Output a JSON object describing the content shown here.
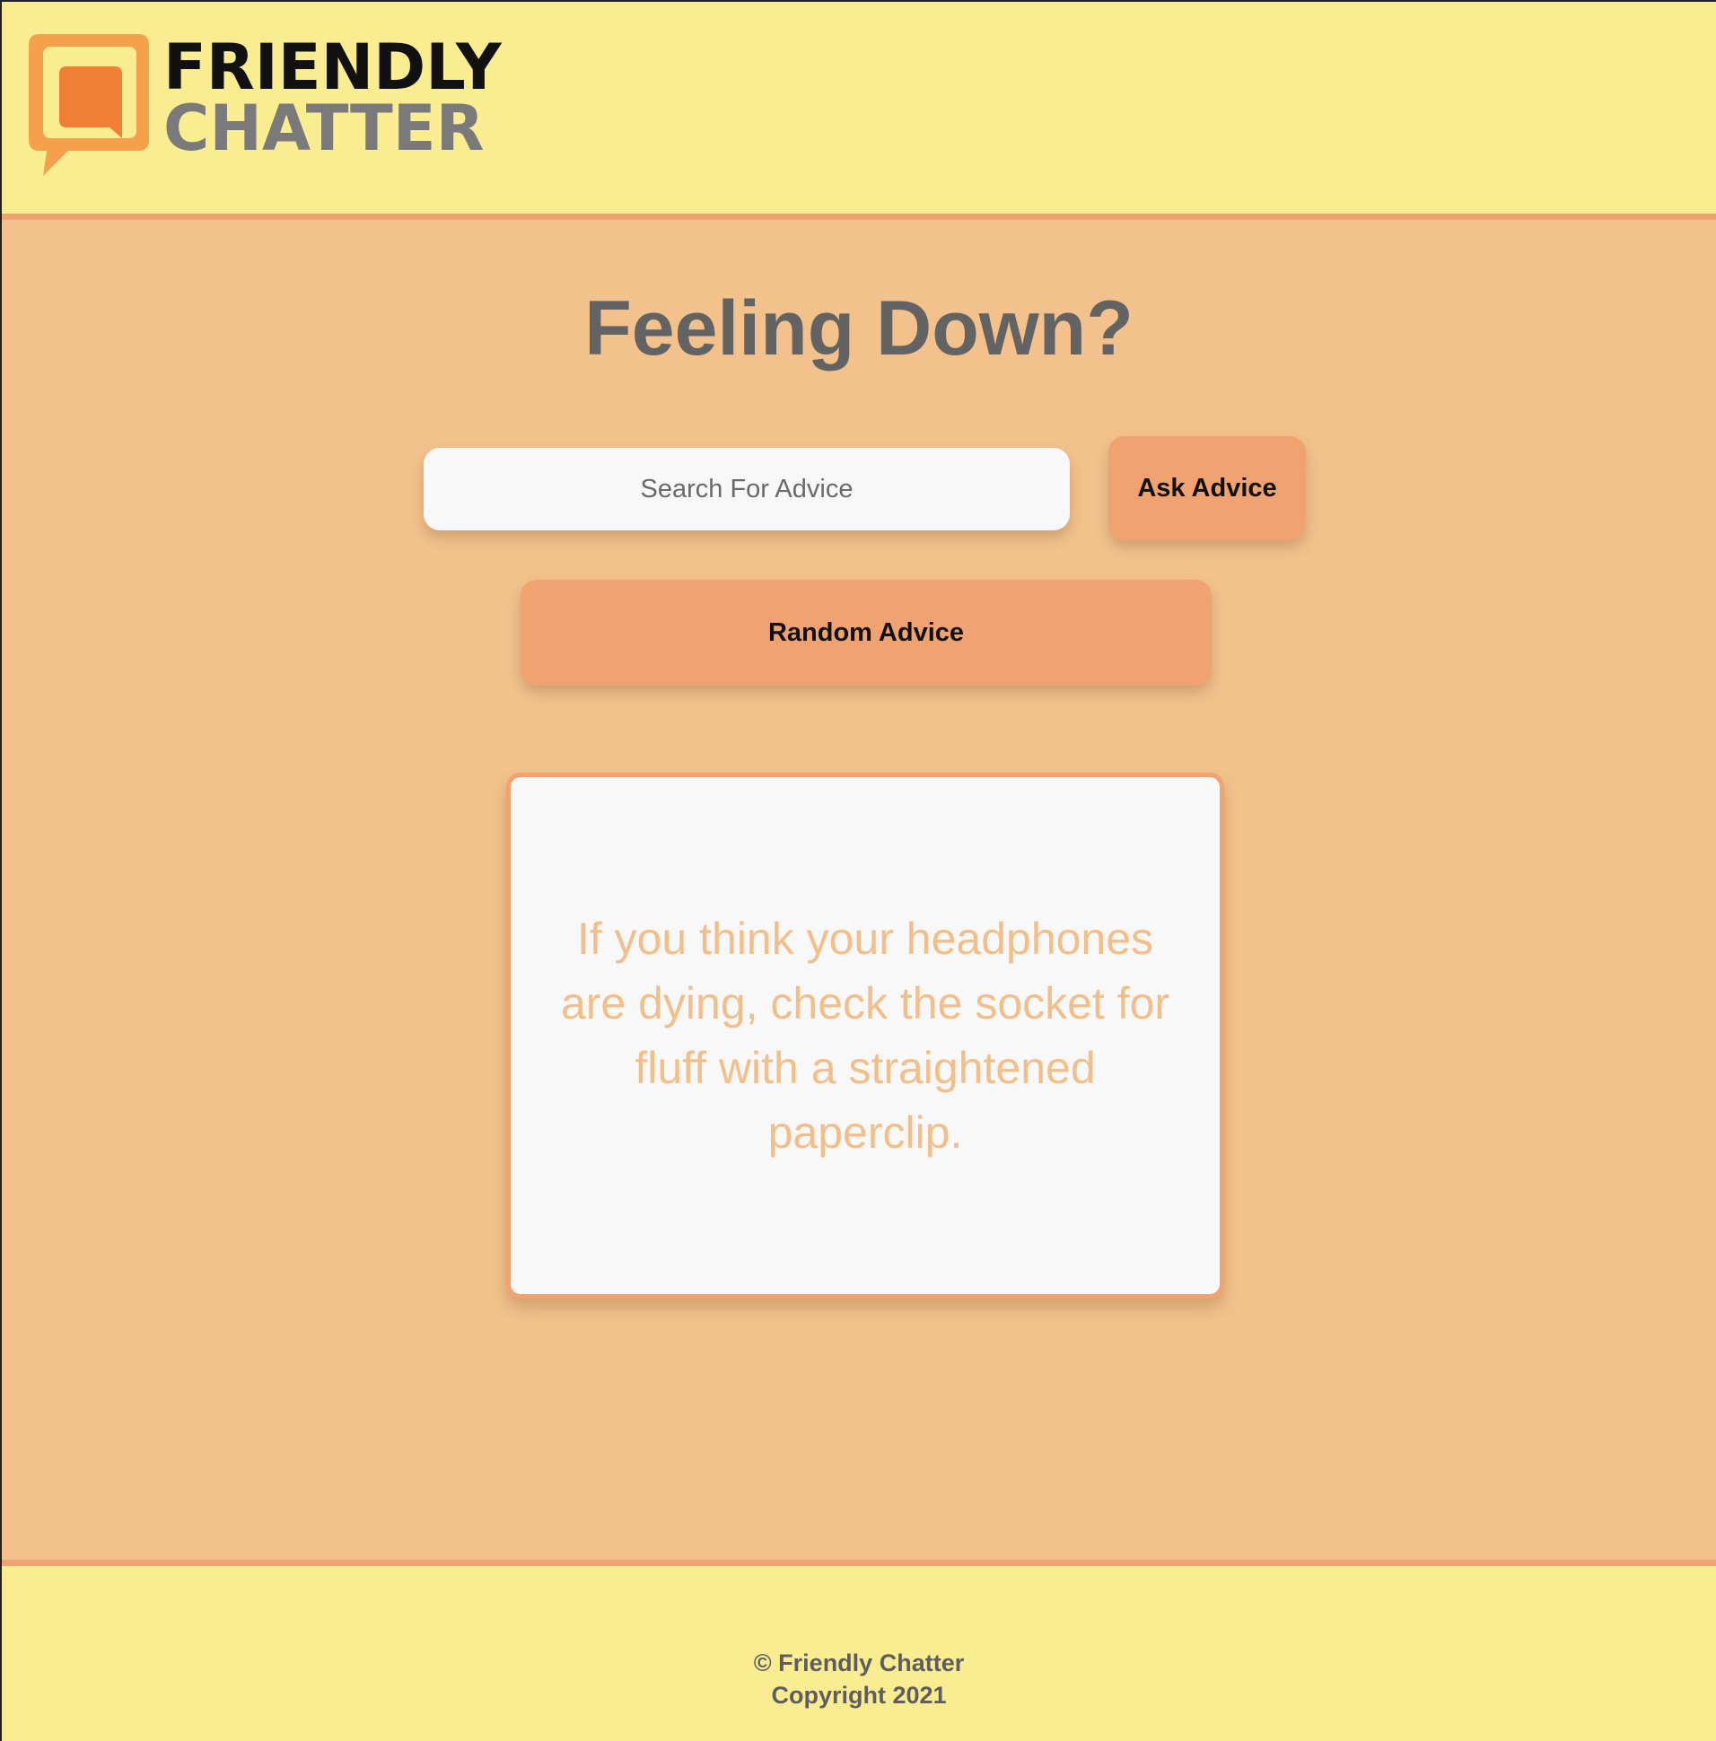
{
  "brand": {
    "line1": "FRIENDLY",
    "line2": "CHATTER",
    "logo_icon": "speech-bubble-icon",
    "colors": {
      "header_bg": "#faed91",
      "main_bg": "#f2c18c",
      "accent": "#f0a271",
      "logo_orange": "#f08036",
      "logo_frame": "#f5a04a"
    }
  },
  "main": {
    "title": "Feeling Down?",
    "search": {
      "placeholder": "Search For Advice",
      "value": ""
    },
    "ask_label": "Ask Advice",
    "random_label": "Random Advice",
    "advice": "If you think your headphones are dying, check the socket for fluff with a straightened paperclip."
  },
  "footer": {
    "line1": "© Friendly Chatter",
    "line2": "Copyright 2021"
  }
}
